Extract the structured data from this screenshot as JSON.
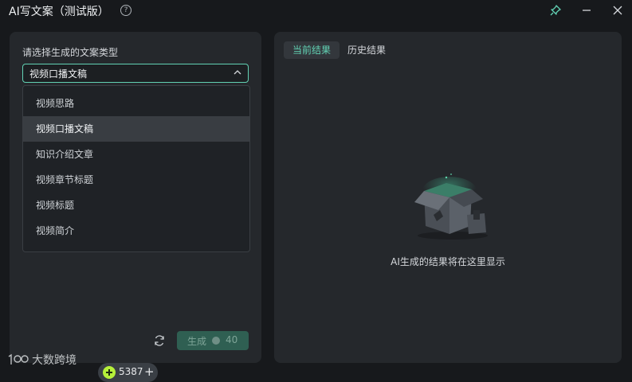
{
  "window": {
    "title": "AI写文案（测试版）"
  },
  "left": {
    "label": "请选择生成的文案类型",
    "select_value": "视频口播文稿",
    "options": [
      "视频思路",
      "视频口播文稿",
      "知识介绍文章",
      "视频章节标题",
      "视频标题",
      "视频简介"
    ],
    "selected_index": 1,
    "credits": "5387",
    "generate_label": "生成",
    "generate_cost": "40"
  },
  "right": {
    "tabs": [
      "当前结果",
      "历史结果"
    ],
    "active_tab": 0,
    "empty_text": "AI生成的结果将在这里显示"
  },
  "watermark": {
    "text": "大数跨境"
  },
  "colors": {
    "accent": "#62d2b4",
    "coin": "#b6f03a",
    "panel": "#25282c",
    "background": "#17191c"
  }
}
